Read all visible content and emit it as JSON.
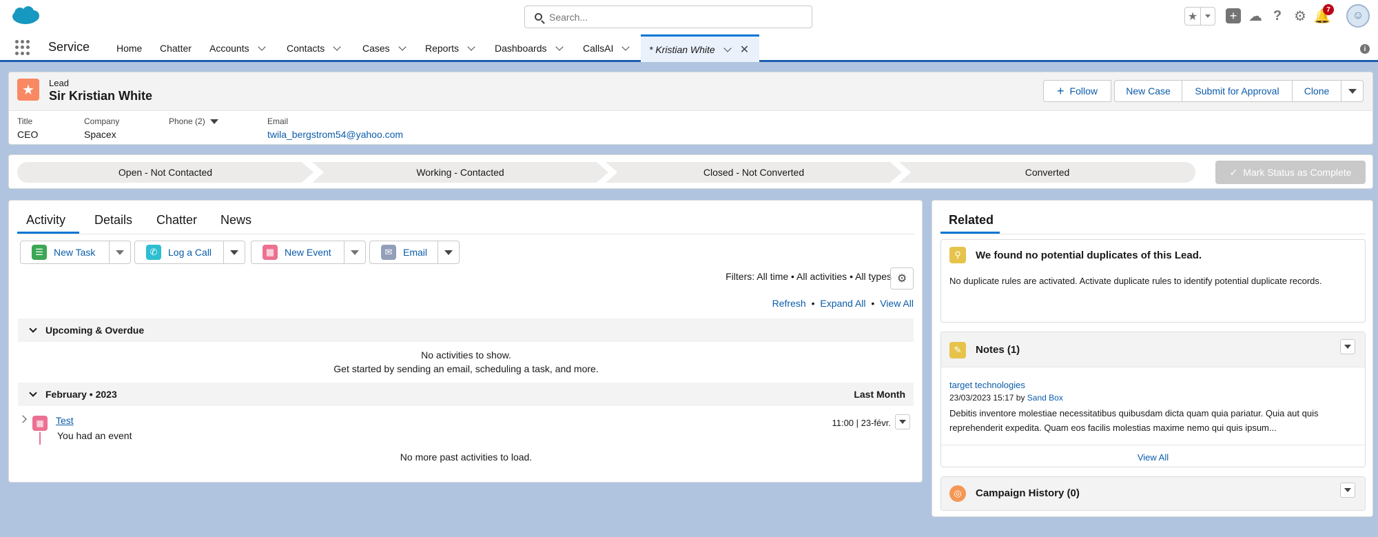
{
  "header": {
    "search_placeholder": "Search...",
    "notifications_count": "7"
  },
  "nav": {
    "app_name": "Service",
    "items": [
      "Home",
      "Chatter",
      "Accounts",
      "Contacts",
      "Cases",
      "Reports",
      "Dashboards",
      "CallsAI"
    ],
    "active_tab": "* Kristian White"
  },
  "record": {
    "object_label": "Lead",
    "name": "Sir Kristian White",
    "actions": {
      "follow": "Follow",
      "new_case": "New Case",
      "submit": "Submit for Approval",
      "clone": "Clone"
    },
    "fields": {
      "title_label": "Title",
      "title_value": "CEO",
      "company_label": "Company",
      "company_value": "Spacex",
      "phone_label": "Phone (2)",
      "email_label": "Email",
      "email_value": "twila_bergstrom54@yahoo.com"
    }
  },
  "path": {
    "stages": [
      "Open - Not Contacted",
      "Working - Contacted",
      "Closed - Not Converted",
      "Converted"
    ],
    "mark_complete": "Mark Status as Complete"
  },
  "activity": {
    "tabs": [
      "Activity",
      "Details",
      "Chatter",
      "News"
    ],
    "buttons": {
      "new_task": "New Task",
      "log_call": "Log a Call",
      "new_event": "New Event",
      "email": "Email"
    },
    "filters": "Filters: All time • All activities • All types",
    "links": {
      "refresh": "Refresh",
      "expand_all": "Expand All",
      "view_all": "View All",
      "sep": "•"
    },
    "upcoming": {
      "title": "Upcoming & Overdue",
      "empty_line1": "No activities to show.",
      "empty_line2": "Get started by sending an email, scheduling a task, and more."
    },
    "month": {
      "title": "February • 2023",
      "right": "Last Month"
    },
    "event": {
      "title": "Test",
      "desc": "You had an event",
      "time": "11:00 | 23-févr."
    },
    "no_more": "No more past activities to load."
  },
  "related": {
    "tab": "Related",
    "duplicates": {
      "title": "We found no potential duplicates of this Lead.",
      "body": "No duplicate rules are activated. Activate duplicate rules to identify potential duplicate records."
    },
    "notes": {
      "title": "Notes (1)",
      "note_title": "target technologies",
      "note_date": "23/03/2023 15:17",
      "by": "by",
      "author": "Sand Box",
      "note_body": "Debitis inventore molestiae necessitatibus quibusdam dicta quam quia pariatur. Quia aut quis reprehenderit expedita. Quam eos facilis molestias maxime nemo qui quis ipsum...",
      "view_all": "View All"
    },
    "campaign": {
      "title": "Campaign History (0)"
    }
  },
  "colors": {
    "brand_blue": "#0176d3",
    "lead_orange": "#f88962",
    "task_green": "#3ba755",
    "call_teal": "#2ebed1",
    "event_pink": "#eb7092",
    "email_gray": "#939fb9",
    "notes_yellow": "#e6c34b",
    "campaign_orange": "#f49756"
  }
}
